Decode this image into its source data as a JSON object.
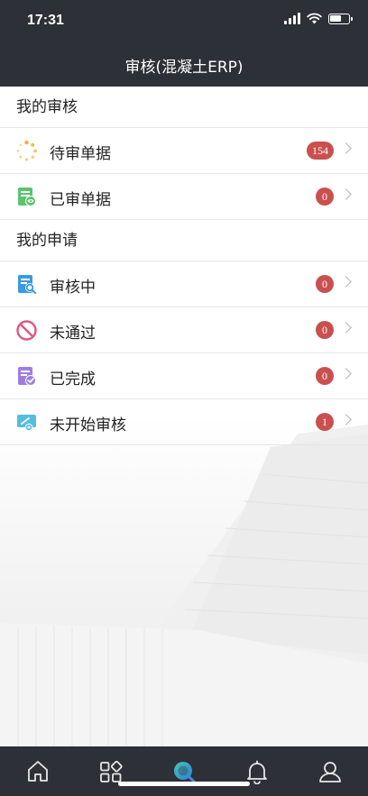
{
  "status_bar": {
    "time": "17:31"
  },
  "header": {
    "title": "审核(混凝土ERP)"
  },
  "sections": [
    {
      "title": "我的审核",
      "items": [
        {
          "label": "待审单据",
          "badge": "154"
        },
        {
          "label": "已审单据",
          "badge": "0"
        }
      ]
    },
    {
      "title": "我的申请",
      "items": [
        {
          "label": "审核中",
          "badge": "0"
        },
        {
          "label": "未通过",
          "badge": "0"
        },
        {
          "label": "已完成",
          "badge": "0"
        },
        {
          "label": "未开始审核",
          "badge": "1"
        }
      ]
    }
  ],
  "tabbar": {
    "tabs": [
      {
        "icon": "home-icon"
      },
      {
        "icon": "apps-grid-icon"
      },
      {
        "icon": "audit-search-icon",
        "active": true
      },
      {
        "icon": "bell-icon"
      },
      {
        "icon": "user-icon"
      }
    ]
  },
  "colors": {
    "header_bg": "#2d3037",
    "badge_bg": "#c9504f",
    "active_tab_accent": "#3bb6c4"
  }
}
